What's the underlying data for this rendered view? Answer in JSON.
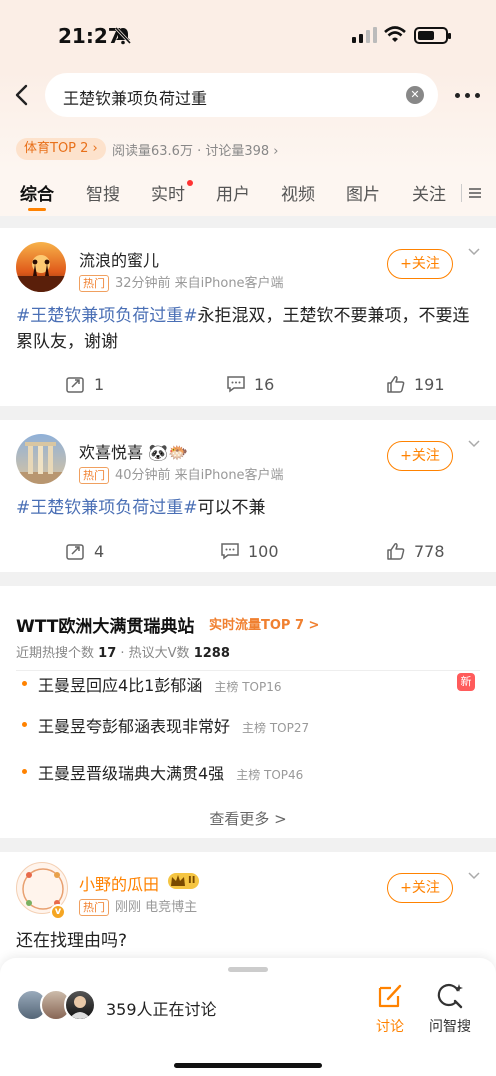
{
  "status": {
    "time": "21:27"
  },
  "search": {
    "query": "王楚钦兼项负荷过重"
  },
  "topic_meta": {
    "badge": "体育TOP 2",
    "stats": "阅读量63.6万 · 讨论量398"
  },
  "tabs": [
    {
      "label": "综合"
    },
    {
      "label": "智搜"
    },
    {
      "label": "实时"
    },
    {
      "label": "用户"
    },
    {
      "label": "视频"
    },
    {
      "label": "图片"
    },
    {
      "label": "关注"
    }
  ],
  "posts": [
    {
      "username": "流浪的蜜儿",
      "hot": "热门",
      "meta": "32分钟前  来自iPhone客户端",
      "follow": "+关注",
      "topic": "#王楚钦兼项负荷过重#",
      "text": "永拒混双，王楚钦不要兼项，不要连累队友，谢谢",
      "reposts": "1",
      "comments": "16",
      "likes": "191"
    },
    {
      "username": "欢喜悦喜",
      "emoji": "🐼🐡",
      "hot": "热门",
      "meta": "40分钟前  来自iPhone客户端",
      "follow": "+关注",
      "topic": "#王楚钦兼项负荷过重#",
      "text": "可以不兼",
      "reposts": "4",
      "comments": "100",
      "likes": "778"
    }
  ],
  "trend": {
    "title": "WTT欧洲大满贯瑞典站",
    "badge": "实时流量TOP 7 >",
    "stats_prefix": "近期热搜个数",
    "stats_count": "17",
    "stats_mid": " · 热议大V数",
    "stats_vcount": "1288",
    "items": [
      {
        "text": "王曼昱回应4比1彭郁涵",
        "rank": "主榜 TOP16",
        "badge": "新"
      },
      {
        "text": "王曼昱夸彭郁涵表现非常好",
        "rank": "主榜 TOP27"
      },
      {
        "text": "王曼昱晋级瑞典大满贯4强",
        "rank": "主榜 TOP46"
      }
    ],
    "see_more": "查看更多 >"
  },
  "post3": {
    "username": "小野的瓜田",
    "level": "II",
    "hot": "热门",
    "meta": "刚刚  电竞博主",
    "follow": "+关注",
    "text": "还在找理由吗?"
  },
  "bottom": {
    "discussing": "359人正在讨论",
    "discuss_label": "讨论",
    "ask_label": "问智搜"
  },
  "colors": {
    "accent": "#ff8200",
    "topic": "#4a6fb5",
    "hot": "#f08030"
  }
}
